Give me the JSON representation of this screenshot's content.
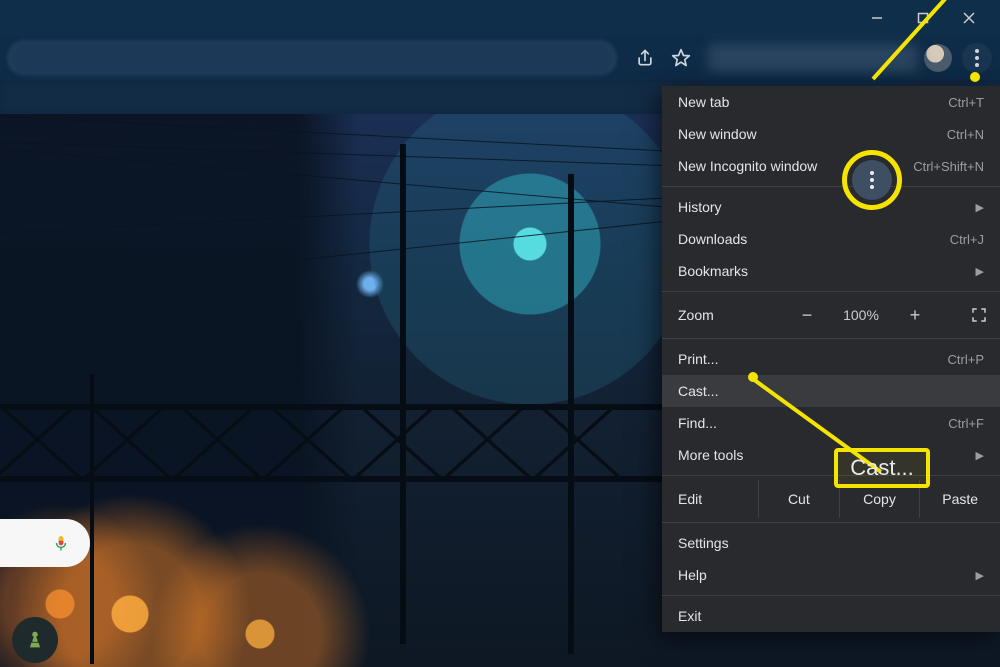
{
  "menu": {
    "new_tab": {
      "label": "New tab",
      "kbd": "Ctrl+T"
    },
    "new_window": {
      "label": "New window",
      "kbd": "Ctrl+N"
    },
    "incognito": {
      "label": "New Incognito window",
      "kbd": "Ctrl+Shift+N"
    },
    "history": {
      "label": "History"
    },
    "downloads": {
      "label": "Downloads",
      "kbd": "Ctrl+J"
    },
    "bookmarks": {
      "label": "Bookmarks"
    },
    "zoom": {
      "label": "Zoom",
      "minus": "−",
      "value": "100%",
      "plus": "+"
    },
    "print": {
      "label": "Print...",
      "kbd": "Ctrl+P"
    },
    "cast": {
      "label": "Cast..."
    },
    "find": {
      "label": "Find...",
      "kbd": "Ctrl+F"
    },
    "more_tools": {
      "label": "More tools"
    },
    "edit": {
      "label": "Edit",
      "cut": "Cut",
      "copy": "Copy",
      "paste": "Paste"
    },
    "settings": {
      "label": "Settings"
    },
    "help": {
      "label": "Help"
    },
    "exit": {
      "label": "Exit"
    }
  },
  "annotation": {
    "callout": "Cast..."
  }
}
